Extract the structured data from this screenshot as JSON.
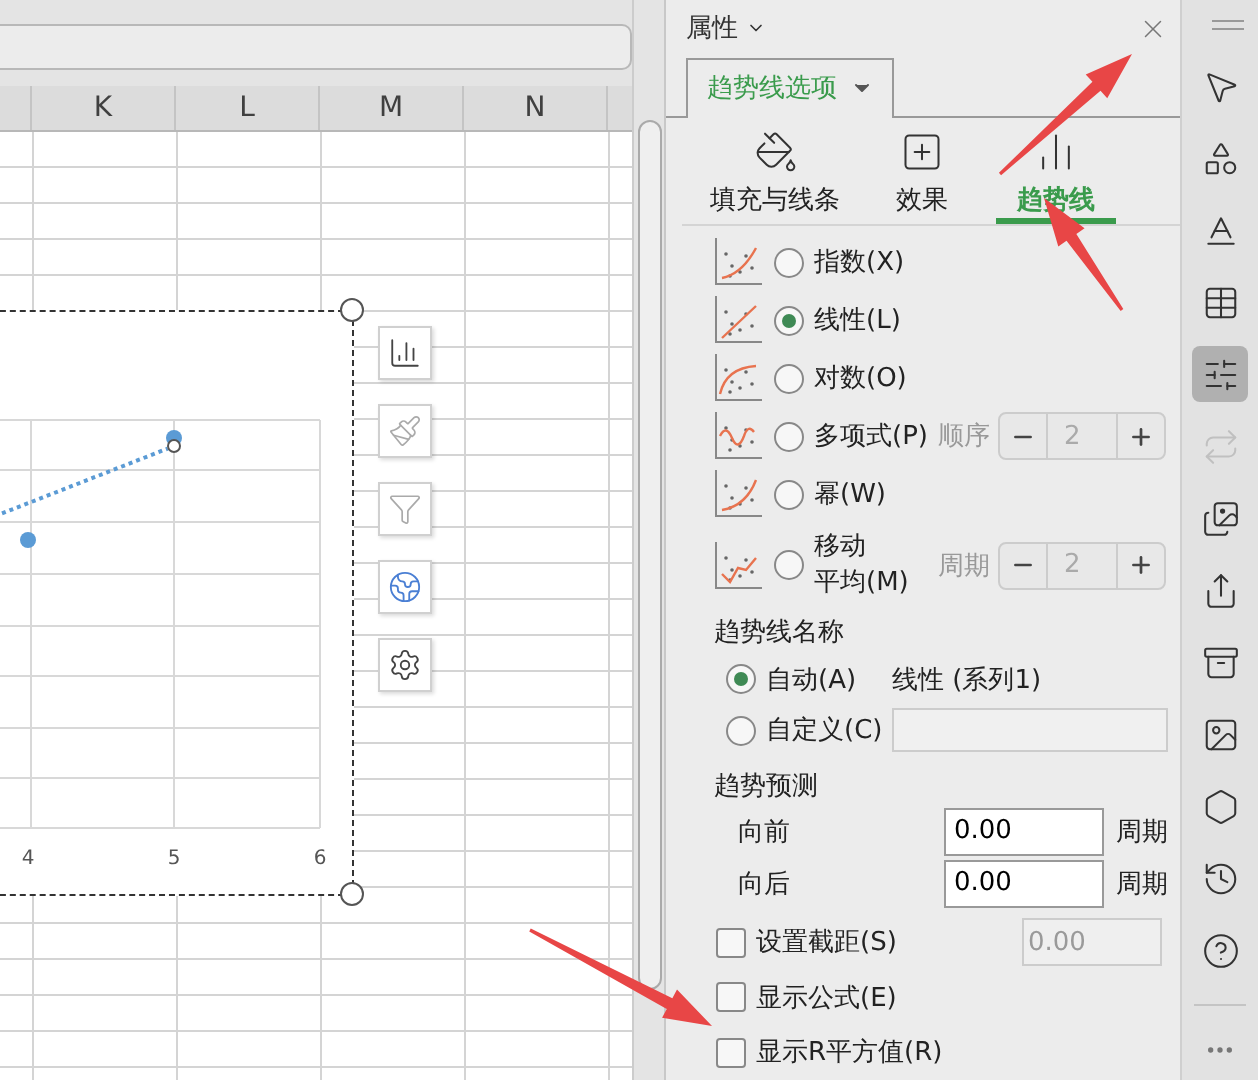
{
  "sheet": {
    "columns": [
      "K",
      "L",
      "M",
      "N"
    ]
  },
  "chart": {
    "x_tick_labels": [
      "4",
      "5",
      "6"
    ]
  },
  "panel": {
    "title": "属性",
    "section_tab": "趋势线选项",
    "tabs": [
      {
        "label": "填充与线条",
        "selected": false
      },
      {
        "label": "效果",
        "selected": false
      },
      {
        "label": "趋势线",
        "selected": true
      }
    ],
    "trend_types": [
      {
        "kind": "plain",
        "lines": [
          "指数(X)"
        ],
        "selected": false
      },
      {
        "kind": "plain",
        "lines": [
          "线性(L)"
        ],
        "selected": true
      },
      {
        "kind": "plain",
        "lines": [
          "对数(O)"
        ],
        "selected": false
      },
      {
        "kind": "spinner",
        "lines": [
          "多项式(P)"
        ],
        "selected": false,
        "spinner_label": "顺序",
        "spinner_value": "2",
        "spinner_disabled": true
      },
      {
        "kind": "plain",
        "lines": [
          "幂(W)"
        ],
        "selected": false
      },
      {
        "kind": "spinner",
        "lines": [
          "移动",
          "平均(M)"
        ],
        "selected": false,
        "spinner_label": "周期",
        "spinner_value": "2",
        "spinner_disabled": true
      }
    ],
    "trendline_name": {
      "title": "趋势线名称",
      "options": [
        {
          "kind": "auto",
          "label": "自动(A)",
          "selected": true,
          "value": "线性 (系列1)"
        },
        {
          "kind": "custom",
          "label": "自定义(C)",
          "selected": false
        }
      ]
    },
    "forecast": {
      "title": "趋势预测",
      "rows": [
        {
          "label": "向前",
          "value": "0.00",
          "unit": "周期"
        },
        {
          "label": "向后",
          "value": "0.00",
          "unit": "周期"
        }
      ]
    },
    "checkboxes": [
      {
        "label": "设置截距(S)",
        "checked": false,
        "value": "0.00",
        "value_disabled": true
      },
      {
        "label": "显示公式(E)",
        "checked": false
      },
      {
        "label": "显示R平方值(R)",
        "checked": false
      }
    ]
  },
  "toolbar": [
    {
      "kind": "pointer",
      "selected": false,
      "disabled": false
    },
    {
      "kind": "shapes",
      "selected": false,
      "disabled": false
    },
    {
      "kind": "text",
      "selected": false,
      "disabled": false
    },
    {
      "kind": "table",
      "selected": false,
      "disabled": false
    },
    {
      "kind": "properties",
      "selected": true,
      "disabled": false
    },
    {
      "kind": "convert",
      "selected": false,
      "disabled": true
    },
    {
      "kind": "images",
      "selected": false,
      "disabled": false
    },
    {
      "kind": "share",
      "selected": false,
      "disabled": false
    },
    {
      "kind": "archive",
      "selected": false,
      "disabled": false
    },
    {
      "kind": "image",
      "selected": false,
      "disabled": false
    },
    {
      "kind": "badge",
      "selected": false,
      "disabled": false
    },
    {
      "kind": "history",
      "selected": false,
      "disabled": false
    },
    {
      "kind": "help",
      "selected": false,
      "disabled": false
    }
  ]
}
